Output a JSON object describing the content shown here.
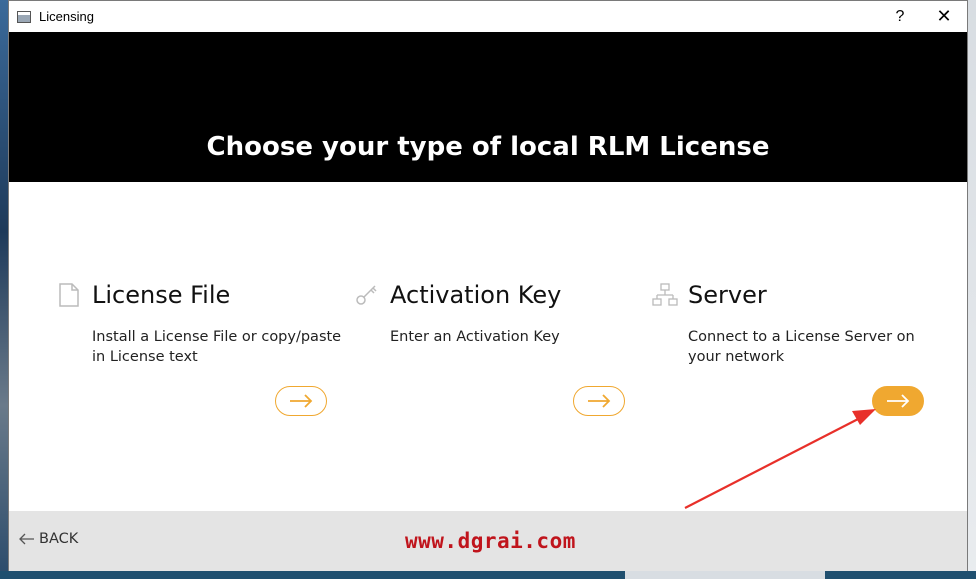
{
  "window": {
    "title": "Licensing",
    "help_label": "?",
    "close_label": "✕"
  },
  "header": {
    "title": "Choose your type of local RLM License"
  },
  "options": [
    {
      "title": "License File",
      "description": "Install a License File or copy/paste in License text",
      "icon": "document-icon"
    },
    {
      "title": "Activation Key",
      "description": "Enter an Activation Key",
      "icon": "key-icon"
    },
    {
      "title": "Server",
      "description": "Connect to a License Server on your network",
      "icon": "network-icon"
    }
  ],
  "footer": {
    "back_label": "BACK",
    "watermark": "www.dgrai.com"
  },
  "colors": {
    "accent": "#f0a830",
    "header_bg": "#000000",
    "footer_bg": "#e4e4e4",
    "annotation_arrow": "#e8302a",
    "watermark": "#c0141c"
  }
}
